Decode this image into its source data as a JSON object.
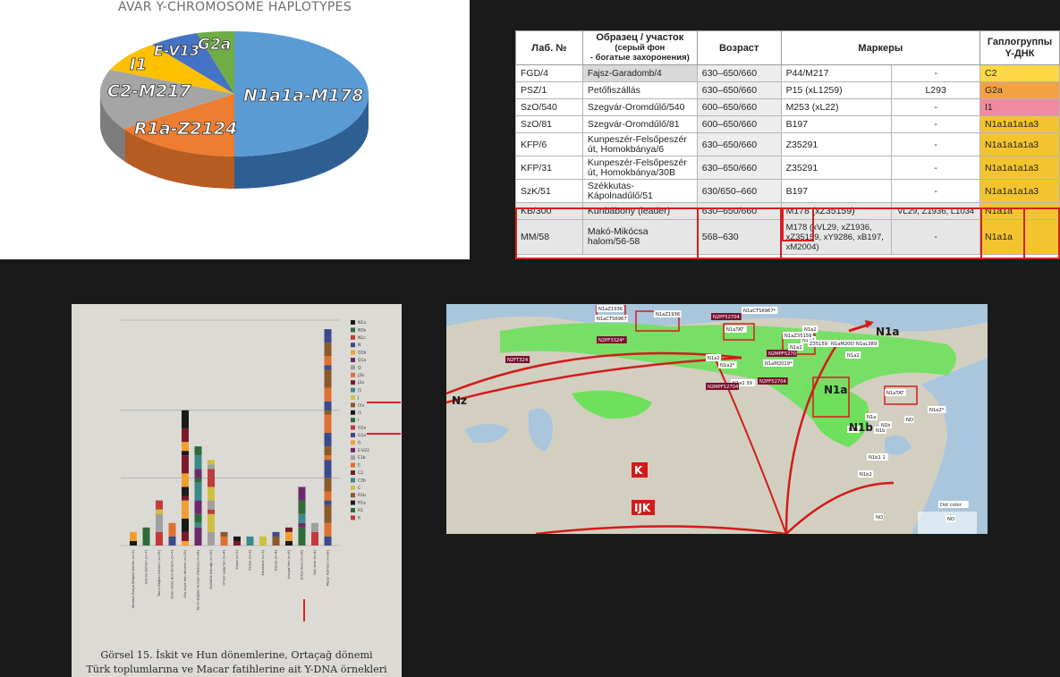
{
  "pie_panel": {
    "title": "AVAR Y-CHROMOSOME HAPLOTYPES",
    "slices": [
      {
        "label": "N1a1a-M178",
        "value": 55,
        "color": "#5b9bd5"
      },
      {
        "label": "R1a-Z2124",
        "value": 17,
        "color": "#ed7d31"
      },
      {
        "label": "C2-M217",
        "value": 11,
        "color": "#a5a5a5"
      },
      {
        "label": "I1",
        "value": 6,
        "color": "#ffc000"
      },
      {
        "label": "E-V13",
        "value": 6,
        "color": "#4472c4"
      },
      {
        "label": "G2a",
        "value": 5,
        "color": "#70ad47"
      }
    ]
  },
  "haplo_table": {
    "headers": {
      "lab": "Лаб. №",
      "sample_1": "Образец / участок",
      "sample_2": "(серый фон",
      "sample_3": "- богатые захоронения)",
      "age": "Возраст",
      "markers": "Маркеры",
      "hg_1": "Гаплогруппы",
      "hg_2": "Y-ДНК"
    },
    "rows": [
      {
        "lab": "FGD/4",
        "site": "Fajsz-Garadomb/4",
        "age": "630–650/660",
        "m1": "P44/M217",
        "m2": "-",
        "hg": "C2"
      },
      {
        "lab": "PSZ/1",
        "site": "Petőfiszállás",
        "age": "630–650/660",
        "m1": "P15 (xL1259)",
        "m2": "L293",
        "hg": "G2a"
      },
      {
        "lab": "SzO/540",
        "site": "Szegvár-Oromdűlő/540",
        "age": "600–650/660",
        "m1": "M253 (xL22)",
        "m2": "-",
        "hg": "I1"
      },
      {
        "lab": "SzO/81",
        "site": "Szegvár-Oromdűlő/81",
        "age": "600–650/660",
        "m1": "B197",
        "m2": "-",
        "hg": "N1a1a1a1a3"
      },
      {
        "lab": "KFP/6",
        "site": "Kunpeszér-Felsőpeszér út, Homokbánya/6",
        "age": "630–650/660",
        "m1": "Z35291",
        "m2": "-",
        "hg": "N1a1a1a1a3"
      },
      {
        "lab": "KFP/31",
        "site": "Kunpeszér-Felsőpeszér út, Homokbánya/30B",
        "age": "630–650/660",
        "m1": "Z35291",
        "m2": "-",
        "hg": "N1a1a1a1a3"
      },
      {
        "lab": "SzK/51",
        "site": "Székkutas-Kápolnadűlő/51",
        "age": "630/650–660",
        "m1": "B197",
        "m2": "-",
        "hg": "N1a1a1a1a3"
      },
      {
        "lab": "KB/300",
        "site": "Kunbábony (leader)",
        "age": "630–650/660",
        "m1": "M178 (xZ35159)",
        "m2": "VL29, Z1936, L1034",
        "hg": "N1a1a"
      },
      {
        "lab": "MM/58",
        "site": "Makó-Mikócsa halom/56-58",
        "age": "568–630",
        "m1": "M178 (xVL29, xZ1936, xZ35159, xY9286, xB197, xM2004)",
        "m2": "-",
        "hg": "N1a1a"
      }
    ]
  },
  "bar_photo": {
    "caption_1": "Görsel 15. İskit ve Hun dönemlerine, Ortaçağ dönemi",
    "caption_2": "Türk toplumlarına ve Macar fatihlerine ait Y-DNA örnekleri grafiği.",
    "legend": [
      "N1a",
      "N1b",
      "N1c",
      "N",
      "Q1b",
      "Q1a",
      "Q",
      "J2b",
      "J2a",
      "J1",
      "J",
      "I2a",
      "I1",
      "I",
      "G2a",
      "G1a",
      "G",
      "E-V22",
      "E1b",
      "E",
      "C2",
      "C2b",
      "C",
      "R1b",
      "R1a",
      "R1",
      "R"
    ],
    "categories": [
      "Merkezi Rusya Bölgesi İskitler (n=3)",
      "Sibirya İskitleri (n=7)",
      "Tarım Dağları İskitleri (n=15)",
      "Erken Asya Hun dönemi (n=7)",
      "Geç Asya Hun dönemi (n=29)",
      "Tarım Dağları Hunları (Yüebei) (n=24)",
      "Sürkülük Kalpağı (n=19)",
      "Orhon uygurları (n=4)",
      "Kırgız (n=3)",
      "Karluk (n=3)",
      "Karahanlı (n=3)",
      "Kıpçak (n=4)",
      "Avrupa Hun (n=6)",
      "Erken Avar (n=16)",
      "Geç Avar (n=4)",
      "Macar Fatihleri (n=39)"
    ],
    "totals": [
      3,
      4,
      10,
      5,
      30,
      22,
      19,
      3,
      2,
      2,
      2,
      3,
      4,
      13,
      5,
      48
    ]
  },
  "map": {
    "labels": [
      "N1aZ1936",
      "N1aCTS6967",
      "N1aZ1936",
      "N1aTAT",
      "N2PF52704",
      "N1aCTS6967*",
      "N2FT324",
      "N2PF3324*",
      "N1a2",
      "N1aTAT",
      "N1a2",
      "N1aZ35159",
      "N1aM2005*",
      "N1aL389",
      "N1a2",
      "N1a2*",
      "N1a2",
      "N1aM2019*",
      "N2MPF5270",
      "N1a2",
      "Z35159",
      "N1a2 39",
      "N2PF52704",
      "N2MPF52704",
      "N1aTAT",
      "N1a2*",
      "N1a",
      "N1b",
      "N1b",
      "NO",
      "N1b1 1",
      "N1b2",
      "NO",
      "N1b",
      "Nz",
      "N1a",
      "N1a",
      "N1b",
      "K",
      "IJK",
      "Dot color",
      "NO"
    ]
  }
}
